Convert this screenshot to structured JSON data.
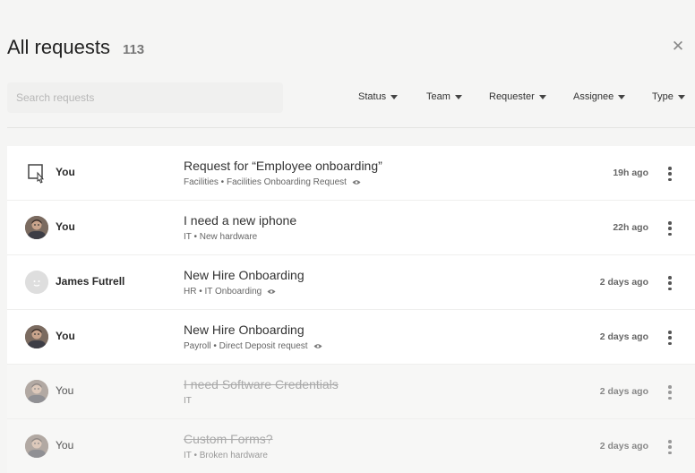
{
  "header": {
    "title": "All requests",
    "count": "113"
  },
  "search": {
    "placeholder": "Search requests"
  },
  "filters": [
    {
      "label": "Status"
    },
    {
      "label": "Team"
    },
    {
      "label": "Requester"
    },
    {
      "label": "Assignee"
    },
    {
      "label": "Type"
    }
  ],
  "rows": [
    {
      "requester": "You",
      "avatar": "request-icon",
      "title": "Request for “Employee onboarding”",
      "subtitle": "Facilities • Facilities Onboarding Request",
      "watched": true,
      "time": "19h ago",
      "closed": false
    },
    {
      "requester": "You",
      "avatar": "photo",
      "title": "I need a new iphone",
      "subtitle": "IT • New hardware",
      "watched": false,
      "time": "22h ago",
      "closed": false
    },
    {
      "requester": "James Futrell",
      "avatar": "placeholder",
      "title": "New Hire Onboarding",
      "subtitle": "HR • IT Onboarding",
      "watched": true,
      "time": "2 days ago",
      "closed": false
    },
    {
      "requester": "You",
      "avatar": "photo",
      "title": "New Hire Onboarding",
      "subtitle": "Payroll • Direct Deposit request",
      "watched": true,
      "time": "2 days ago",
      "closed": false
    },
    {
      "requester": "You",
      "avatar": "photo",
      "title": "I need Software Credentials",
      "subtitle": "IT",
      "watched": false,
      "time": "2 days ago",
      "closed": true
    },
    {
      "requester": "You",
      "avatar": "photo",
      "title": "Custom Forms?",
      "subtitle": "IT • Broken hardware",
      "watched": false,
      "time": "2 days ago",
      "closed": true
    }
  ],
  "colors": {
    "background": "#f5f5f4",
    "row": "#ffffff",
    "text": "#2b2b2b",
    "muted": "#666666"
  }
}
